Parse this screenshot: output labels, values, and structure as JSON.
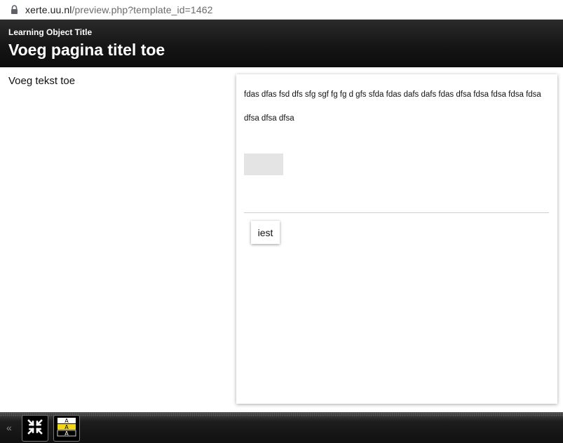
{
  "browser": {
    "url_host": "xerte.uu.nl",
    "url_path": "/preview.php?template_id=1462",
    "lock_icon": "lock-icon"
  },
  "header": {
    "learning_object_title": "Learning Object Title",
    "page_title": "Voeg pagina titel toe",
    "background_color": "#141414"
  },
  "content": {
    "left_text": "Voeg tekst toe",
    "panel_text": "fdas dfas fsd dfs sfg sgf fg fg d gfs sfda fdas dafs dafs fdas dfsa fdsa fdsa fdsa fdsa dfsa dfsa dfsa",
    "tab_label": "iest"
  },
  "footer": {
    "nav_icon": "double-chevron-left-icon",
    "buttons": [
      {
        "icon": "minimize-icon"
      },
      {
        "icon": "colour-changer-icon"
      }
    ],
    "highlight_color": "#f2d515"
  }
}
